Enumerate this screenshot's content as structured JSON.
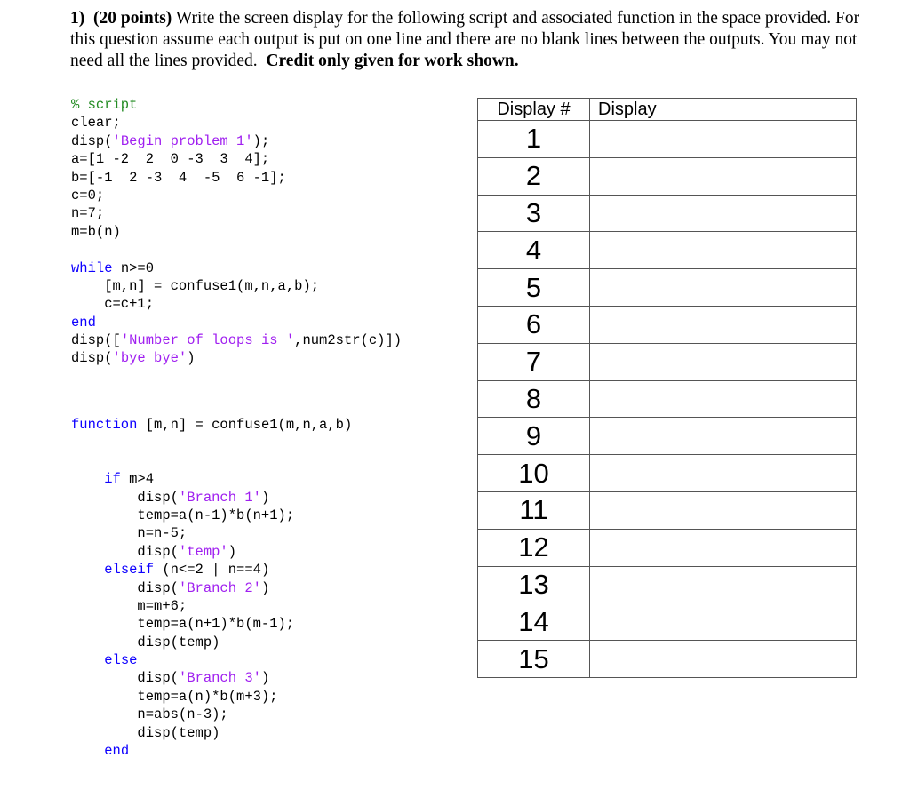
{
  "question": {
    "number": "1)",
    "points": "(20 points)",
    "text": "Write the screen display for the following script and associated function in the space provided.  For this question assume each output is put on one line and there are no blank lines between the outputs.  You may not need all the lines provided.",
    "emphasis": "Credit only given for work shown."
  },
  "script": {
    "lines": [
      [
        {
          "t": "% script",
          "c": "cmt"
        }
      ],
      [
        {
          "t": "clear;",
          "c": ""
        }
      ],
      [
        {
          "t": "disp(",
          "c": ""
        },
        {
          "t": "'Begin problem 1'",
          "c": "str"
        },
        {
          "t": ");",
          "c": ""
        }
      ],
      [
        {
          "t": "a=[1 -2  2  0 -3  3  4];",
          "c": ""
        }
      ],
      [
        {
          "t": "b=[-1  2 -3  4  -5  6 -1];",
          "c": ""
        }
      ],
      [
        {
          "t": "c=0;",
          "c": ""
        }
      ],
      [
        {
          "t": "n=7;",
          "c": ""
        }
      ],
      [
        {
          "t": "m=b(n)",
          "c": ""
        }
      ],
      [
        {
          "t": "",
          "c": ""
        }
      ],
      [
        {
          "t": "while",
          "c": "kw"
        },
        {
          "t": " n>=0",
          "c": ""
        }
      ],
      [
        {
          "t": "    [m,n] = confuse1(m,n,a,b);",
          "c": ""
        }
      ],
      [
        {
          "t": "    c=c+1;",
          "c": ""
        }
      ],
      [
        {
          "t": "end",
          "c": "kw"
        }
      ],
      [
        {
          "t": "disp([",
          "c": ""
        },
        {
          "t": "'Number of loops is '",
          "c": "str"
        },
        {
          "t": ",num2str(c)])",
          "c": ""
        }
      ],
      [
        {
          "t": "disp(",
          "c": ""
        },
        {
          "t": "'bye bye'",
          "c": "str"
        },
        {
          "t": ")",
          "c": ""
        }
      ]
    ]
  },
  "function": {
    "lines": [
      [
        {
          "t": "function",
          "c": "kw"
        },
        {
          "t": " [m,n] = confuse1(m,n,a,b)",
          "c": ""
        }
      ],
      [
        {
          "t": "",
          "c": ""
        }
      ],
      [
        {
          "t": "",
          "c": ""
        }
      ],
      [
        {
          "t": "    ",
          "c": ""
        },
        {
          "t": "if",
          "c": "kw"
        },
        {
          "t": " m>4",
          "c": ""
        }
      ],
      [
        {
          "t": "        disp(",
          "c": ""
        },
        {
          "t": "'Branch 1'",
          "c": "str"
        },
        {
          "t": ")",
          "c": ""
        }
      ],
      [
        {
          "t": "        temp=a(n-1)*b(n+1);",
          "c": ""
        }
      ],
      [
        {
          "t": "        n=n-5;",
          "c": ""
        }
      ],
      [
        {
          "t": "        disp(",
          "c": ""
        },
        {
          "t": "'temp'",
          "c": "str"
        },
        {
          "t": ")",
          "c": ""
        }
      ],
      [
        {
          "t": "    ",
          "c": ""
        },
        {
          "t": "elseif",
          "c": "kw"
        },
        {
          "t": " (n<=2 | n==4)",
          "c": ""
        }
      ],
      [
        {
          "t": "        disp(",
          "c": ""
        },
        {
          "t": "'Branch 2'",
          "c": "str"
        },
        {
          "t": ")",
          "c": ""
        }
      ],
      [
        {
          "t": "        m=m+6;",
          "c": ""
        }
      ],
      [
        {
          "t": "        temp=a(n+1)*b(m-1);",
          "c": ""
        }
      ],
      [
        {
          "t": "        disp(temp)",
          "c": ""
        }
      ],
      [
        {
          "t": "    ",
          "c": ""
        },
        {
          "t": "else",
          "c": "kw"
        }
      ],
      [
        {
          "t": "        disp(",
          "c": ""
        },
        {
          "t": "'Branch 3'",
          "c": "str"
        },
        {
          "t": ")",
          "c": ""
        }
      ],
      [
        {
          "t": "        temp=a(n)*b(m+3);",
          "c": ""
        }
      ],
      [
        {
          "t": "        n=abs(n-3);",
          "c": ""
        }
      ],
      [
        {
          "t": "        disp(temp)",
          "c": ""
        }
      ],
      [
        {
          "t": "    ",
          "c": ""
        },
        {
          "t": "end",
          "c": "kw"
        }
      ]
    ]
  },
  "answer_table": {
    "headers": [
      "Display #",
      "Display"
    ],
    "rows": [
      {
        "num": "1",
        "display": ""
      },
      {
        "num": "2",
        "display": ""
      },
      {
        "num": "3",
        "display": ""
      },
      {
        "num": "4",
        "display": ""
      },
      {
        "num": "5",
        "display": ""
      },
      {
        "num": "6",
        "display": ""
      },
      {
        "num": "7",
        "display": ""
      },
      {
        "num": "8",
        "display": ""
      },
      {
        "num": "9",
        "display": ""
      },
      {
        "num": "10",
        "display": ""
      },
      {
        "num": "11",
        "display": ""
      },
      {
        "num": "12",
        "display": ""
      },
      {
        "num": "13",
        "display": ""
      },
      {
        "num": "14",
        "display": ""
      },
      {
        "num": "15",
        "display": ""
      }
    ]
  },
  "colors": {
    "keyword": "#0e00ff",
    "string": "#a020f0",
    "comment": "#228b22",
    "table_border": "#555555"
  }
}
